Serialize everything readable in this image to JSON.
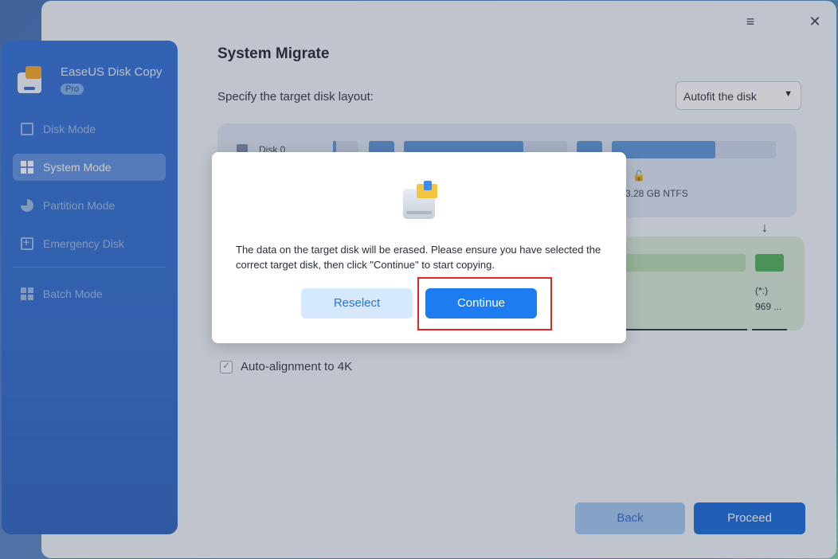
{
  "app": {
    "name": "EaseUS Disk Copy",
    "edition": "Pro"
  },
  "sidebar": {
    "items": [
      {
        "label": "Disk Mode",
        "icon": "disk-icon",
        "active": false
      },
      {
        "label": "System Mode",
        "icon": "windows-icon",
        "active": true
      },
      {
        "label": "Partition Mode",
        "icon": "pie-chart-icon",
        "active": false
      },
      {
        "label": "Emergency Disk",
        "icon": "add-disk-icon",
        "active": false
      },
      {
        "label": "Batch Mode",
        "icon": "grid-icon",
        "active": false
      }
    ]
  },
  "window_controls": {
    "menu": "≡",
    "close": "✕"
  },
  "main": {
    "title": "System Migrate",
    "subtitle": "Specify the target disk layout:",
    "layout_select": {
      "value": "Autofit the disk"
    },
    "source_disk": {
      "label": "Disk 0",
      "partition_info": "3.28 GB NTFS"
    },
    "target_disk": {
      "label1": "(*:)",
      "label2": "969 ..."
    },
    "auto_align": {
      "label": "Auto-alignment to 4K",
      "checked": true
    },
    "back_label": "Back",
    "proceed_label": "Proceed"
  },
  "dialog": {
    "message": "The data on the target disk will be erased. Please ensure you have selected the correct target disk, then click \"Continue\" to start copying.",
    "reselect_label": "Reselect",
    "continue_label": "Continue"
  },
  "colors": {
    "primary": "#1e7cf1",
    "sidebar": "#2f6bcf",
    "highlight": "#e0262b",
    "target_green": "#4fb05a"
  }
}
